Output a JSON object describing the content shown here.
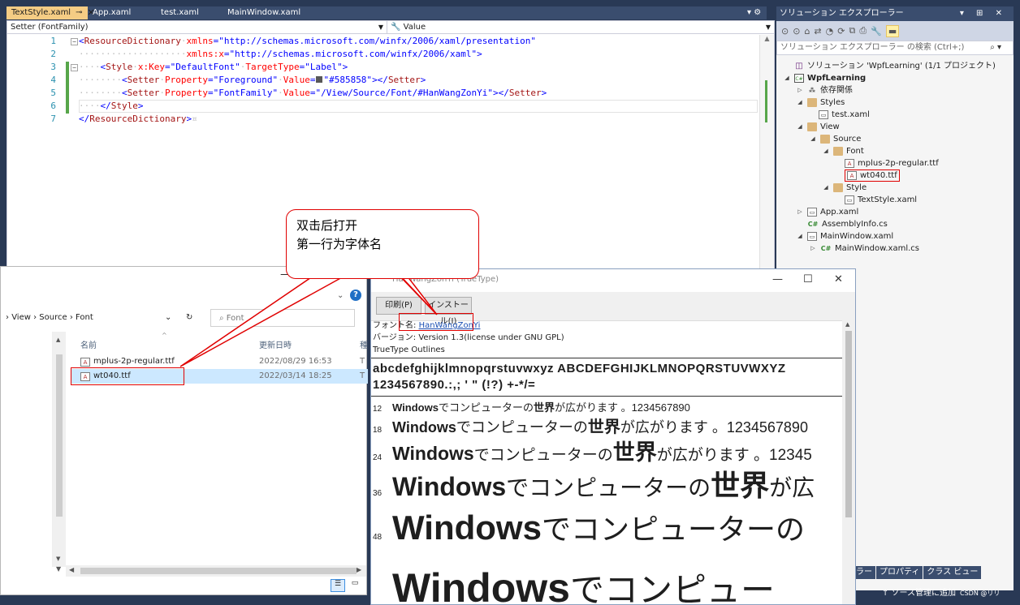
{
  "vs": {
    "tabs": [
      {
        "label": "TextStyle.xaml",
        "pin": "⊸",
        "close": "✕"
      },
      {
        "label": "App.xaml"
      },
      {
        "label": "test.xaml"
      },
      {
        "label": "MainWindow.xaml"
      }
    ],
    "tab_controls": "▾ ⚙",
    "nav_left": "Setter (FontFamily)",
    "nav_right": "Value",
    "line_numbers": [
      "1",
      "2",
      "3",
      "4",
      "5",
      "6",
      "7"
    ],
    "code": {
      "l1_tag": "ResourceDictionary",
      "l1_attr": "xmlns",
      "l1_val": "\"http://schemas.microsoft.com/winfx/2006/xaml/presentation\"",
      "l2_attr": "xmlns:x",
      "l2_val": "\"http://schemas.microsoft.com/winfx/2006/xaml\"",
      "l3_tag": "Style",
      "l3_attr1": "x:Key",
      "l3_val1": "\"DefaultFont\"",
      "l3_attr2": "TargetType",
      "l3_val2": "\"Label\"",
      "l4_tag": "Setter",
      "l4_attr1": "Property",
      "l4_val1": "\"Foreground\"",
      "l4_attr2": "Value",
      "l4_val2": "\"#585858\"",
      "l4_close": "Setter",
      "l5_tag": "Setter",
      "l5_attr1": "Property",
      "l5_val1": "\"FontFamily\"",
      "l5_attr2": "Value",
      "l5_val2": "\"/View/Source/Font/#HanWangZonYi\"",
      "l5_close": "Setter",
      "l6_close": "Style",
      "l7_close": "ResourceDictionary"
    },
    "colors": {
      "accent": "#f5cc84",
      "frame": "#293955",
      "tag": "#a31515",
      "attr": "#ff0000",
      "value": "#0000ff",
      "change": "#57a64a"
    }
  },
  "solution_explorer": {
    "title": "ソリューション エクスプローラー",
    "title_controls": "▾ ⊞ ✕",
    "search_placeholder": "ソリューション エクスプローラー の検索 (Ctrl+;)",
    "tree": [
      {
        "label": "ソリューション 'WpfLearning' (1/1 プロジェクト)",
        "icon": "solution-icon"
      },
      {
        "label": "WpfLearning",
        "icon": "csproj-icon"
      },
      {
        "label": "依存関係",
        "icon": "dependencies-icon"
      },
      {
        "label": "Styles",
        "icon": "folder-icon"
      },
      {
        "label": "test.xaml",
        "icon": "xaml-icon"
      },
      {
        "label": "View",
        "icon": "folder-icon"
      },
      {
        "label": "Source",
        "icon": "folder-icon"
      },
      {
        "label": "Font",
        "icon": "folder-icon"
      },
      {
        "label": "mplus-2p-regular.ttf",
        "icon": "font-file-icon"
      },
      {
        "label": "wt040.ttf",
        "icon": "font-file-icon"
      },
      {
        "label": "Style",
        "icon": "folder-icon"
      },
      {
        "label": "TextStyle.xaml",
        "icon": "xaml-icon"
      },
      {
        "label": "App.xaml",
        "icon": "xaml-icon"
      },
      {
        "label": "AssemblyInfo.cs",
        "icon": "cs-icon"
      },
      {
        "label": "MainWindow.xaml",
        "icon": "xaml-icon"
      },
      {
        "label": "MainWindow.xaml.cs",
        "icon": "cs-icon"
      }
    ],
    "bottom_tabs": [
      "ーラー",
      "プロパティ",
      "クラス ビュー"
    ],
    "status": "↑ ソース管理に追加",
    "status_right": "CSDN @リリ"
  },
  "file_explorer": {
    "path": [
      "View",
      "Source",
      "Font"
    ],
    "search_placeholder": "Font",
    "col_name": "名前",
    "col_date": "更新日時",
    "col_type": "種",
    "files": [
      {
        "name": "mplus-2p-regular.ttf",
        "date": "2022/08/29 16:53",
        "type": "T"
      },
      {
        "name": "wt040.ttf",
        "date": "2022/03/14 18:25",
        "type": "T"
      }
    ]
  },
  "font_viewer": {
    "title": "HanWangZonYi (TrueType)",
    "print_button": "印刷(P)",
    "install_button": "インストール(I)",
    "font_name_label": "フォント名: ",
    "font_name": "HanWangZonYi",
    "version": "バージョン: Version 1.3(license under GNU GPL)",
    "outline": "TrueType Outlines",
    "charset_line1": "abcdefghijklmnopqrstuvwxyz  ABCDEFGHIJKLMNOPQRSTUVWXYZ",
    "charset_line2": "1234567890.:,; ' \" (!?) +-*/=",
    "samples": [
      {
        "size": "12",
        "win": "Windows",
        "pre": " でコンピューターの",
        "sekai": "世界",
        "post": "が広がります 。1234567890"
      },
      {
        "size": "18",
        "win": "Windows",
        "pre": " でコンピューターの",
        "sekai": "世界",
        "post": "が広がります 。1234567890"
      },
      {
        "size": "24",
        "win": "Windows",
        "pre": " でコンピューターの",
        "sekai": "世界",
        "post": "が広がります 。12345"
      },
      {
        "size": "36",
        "win": "Windows",
        "pre": " でコンピューターの",
        "sekai": "世界",
        "post": "が広"
      },
      {
        "size": "48",
        "win": "Windows",
        "pre": " でコンピューターの",
        "sekai": "",
        "post": ""
      },
      {
        "size": "",
        "win": "Windows",
        "pre": " でコンピュー",
        "sekai": "",
        "post": ""
      }
    ]
  },
  "callout": {
    "line1": "双击后打开",
    "line2": "第一行为字体名"
  }
}
